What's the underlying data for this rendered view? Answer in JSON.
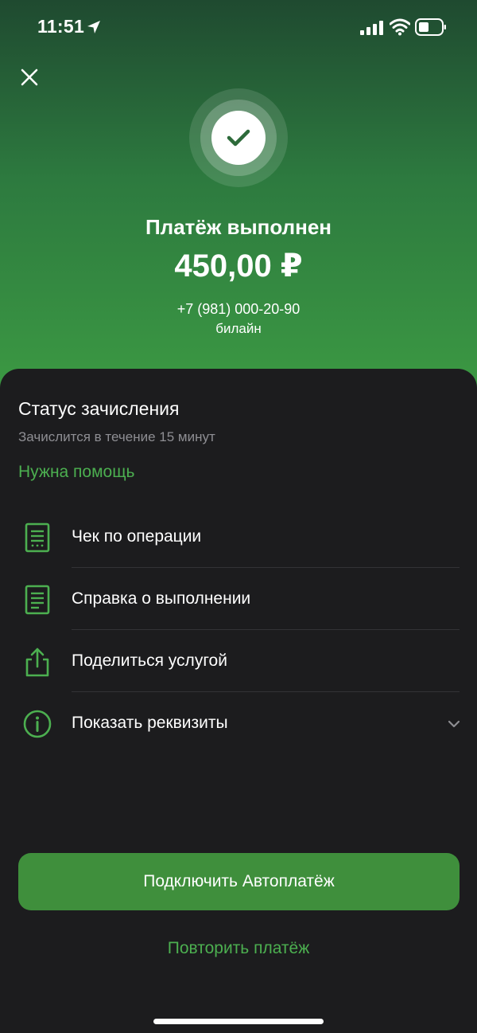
{
  "status_bar": {
    "time": "11:51"
  },
  "header": {
    "title": "Платёж выполнен",
    "amount": "450,00 ₽",
    "phone": "+7 (981) 000-20-90",
    "operator": "билайн"
  },
  "status": {
    "title": "Статус зачисления",
    "subtitle": "Зачислится в течение 15 минут",
    "help_link": "Нужна помощь"
  },
  "menu": [
    {
      "label": "Чек по операции",
      "icon": "receipt-icon"
    },
    {
      "label": "Справка о выполнении",
      "icon": "document-icon"
    },
    {
      "label": "Поделиться услугой",
      "icon": "share-icon"
    },
    {
      "label": "Показать реквизиты",
      "icon": "info-icon"
    }
  ],
  "actions": {
    "primary": "Подключить Автоплатёж",
    "secondary": "Повторить платёж"
  },
  "colors": {
    "accent": "#4caf50",
    "button": "#3f8f3c",
    "sheet": "#1c1c1e",
    "hero_top": "#1f4a30",
    "hero_bottom": "#3c9a43"
  }
}
